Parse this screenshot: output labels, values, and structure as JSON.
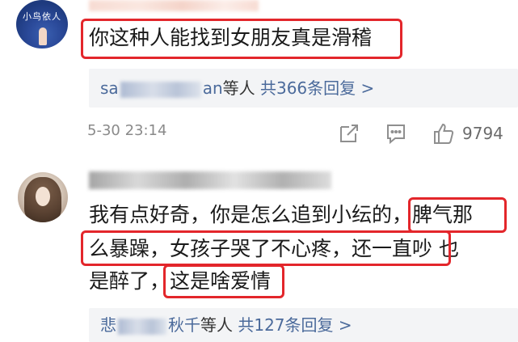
{
  "comment1": {
    "avatar_text": "小鸟依人",
    "text": "你这种人能找到女朋友真是滑稽",
    "replies": {
      "prefix": "sa",
      "suffix": "an",
      "who_text": "等人",
      "count_text": "共366条回复 >"
    },
    "timestamp": "5-30 23:14",
    "like_count": "9794"
  },
  "comment2": {
    "lines": [
      "我有点好奇，你是怎么追到小纭的，脾气那",
      "么暴躁，女孩子哭了不心疼，还一直吵  也",
      "是醉了，这是啥爱情"
    ],
    "replies": {
      "prefix": "悲",
      "suffix": "秋千",
      "who_text": "等人",
      "count_text": "共127条回复 >"
    }
  },
  "colors": {
    "highlight": "#e3262b",
    "link": "#4b6a9b",
    "reply_bg": "#f3f4f6",
    "meta": "#8a8a8a"
  },
  "icons": [
    "share-icon",
    "comment-icon",
    "like-icon"
  ]
}
